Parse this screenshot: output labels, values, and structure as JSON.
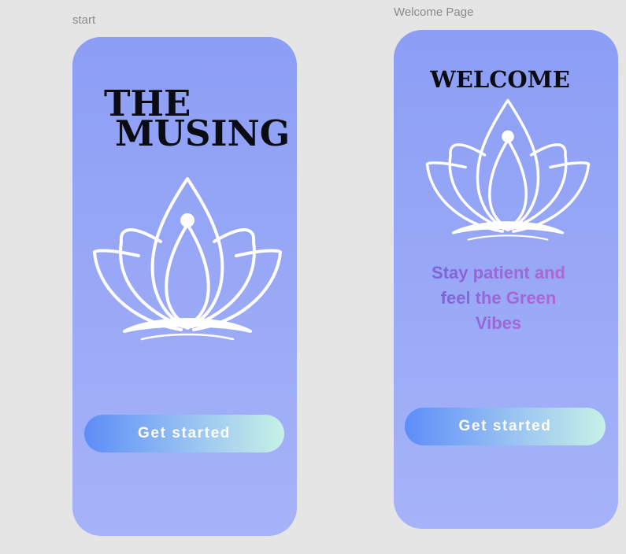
{
  "frames": {
    "start": {
      "label": "start",
      "title_line1": "THE",
      "title_line2": "MUSING",
      "logo_icon": "lotus-meditation-icon",
      "button_label": "Get started"
    },
    "welcome": {
      "label": "Welcome Page",
      "title": "WELCOME",
      "logo_icon": "lotus-meditation-icon",
      "tagline": "Stay patient and feel the Green Vibes",
      "button_label": "Get started"
    }
  },
  "colors": {
    "canvas": "#e5e5e5",
    "frame_top": "#8c9ef5",
    "frame_bottom": "#a6b3f8",
    "button_start": "#5d8df8",
    "button_end": "#c6f1e6",
    "tagline_start": "#6f63d8",
    "tagline_end": "#b865d4"
  }
}
